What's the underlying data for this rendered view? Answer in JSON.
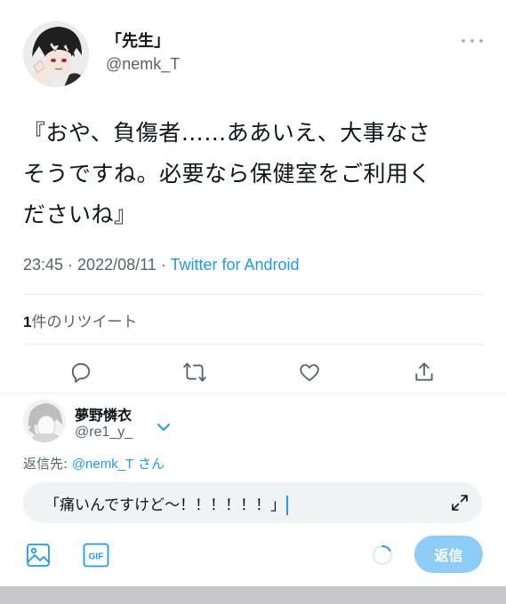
{
  "tweet": {
    "author_name": "「先生」",
    "author_handle": "@nemk_T",
    "text_lines": [
      "『おや、負傷者……ああいえ、大事なさ",
      "そうですね。必要なら保健室をご利用く",
      "ださいね』"
    ],
    "time": "23:45",
    "date": "2022/08/11",
    "separator": " · ",
    "source": "Twitter for Android",
    "retweet_count": "1",
    "retweet_label": "件のリツイート"
  },
  "actions": {
    "reply_icon": "comment-icon",
    "retweet_icon": "retweet-icon",
    "like_icon": "heart-icon",
    "share_icon": "share-icon"
  },
  "reply": {
    "user_name": "夢野憐衣",
    "user_handle": "@re1_y_",
    "reply_to_label": "返信先: ",
    "reply_to_mention": "@nemk_T",
    "reply_to_suffix": " さん",
    "compose_text": "「痛いんですけど〜！！！！！！」",
    "send_label": "返信"
  },
  "colors": {
    "accent": "#1d9bf0",
    "send_button_disabled": "#8ecdf7",
    "muted_text": "#536471"
  }
}
